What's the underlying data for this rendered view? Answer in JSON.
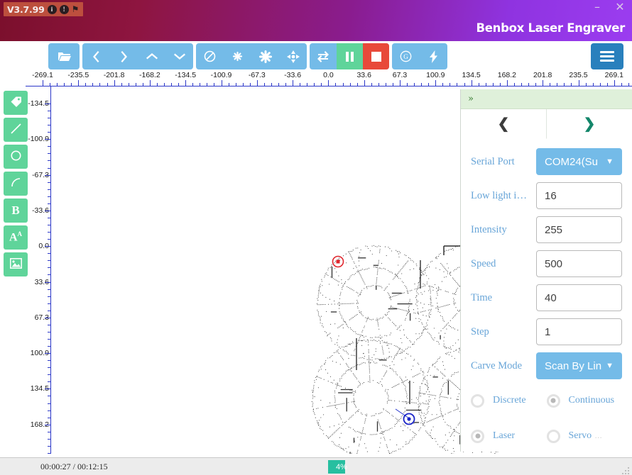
{
  "titlebar": {
    "version": "V3.7.99",
    "icon_info": "i",
    "icon_warn": "!",
    "icon_flag": "⚑",
    "app_title": "Benbox Laser Engraver",
    "minimize": "–",
    "close": "✕"
  },
  "toolbar": {
    "open_label": "folder-open",
    "nav": [
      "left",
      "right",
      "up",
      "down"
    ],
    "ops": [
      "no-entry",
      "asterisk-small",
      "asterisk-large",
      "move-cross"
    ],
    "transfer": "refresh-cycle",
    "pause": "pause",
    "stop": "stop",
    "misc": [
      "g-circle",
      "bolt"
    ],
    "menu": "hamburger"
  },
  "palette": {
    "items": [
      {
        "name": "tag-tool",
        "glyph": "🏷"
      },
      {
        "name": "line-tool",
        "glyph": "╱"
      },
      {
        "name": "circle-tool",
        "glyph": "○"
      },
      {
        "name": "arc-tool",
        "glyph": "⌒"
      },
      {
        "name": "bold-tool",
        "glyph": "B"
      },
      {
        "name": "text-tool",
        "glyph": "Aᴬ"
      },
      {
        "name": "image-tool",
        "glyph": "🖼"
      }
    ]
  },
  "ruler": {
    "top_labels": [
      "-269.1",
      "-235.5",
      "-201.8",
      "-168.2",
      "-134.5",
      "-100.9",
      "-67.3",
      "-33.6",
      "0.0",
      "33.6",
      "67.3",
      "100.9",
      "134.5",
      "168.2",
      "201.8",
      "235.5",
      "269.1"
    ],
    "left_labels": [
      "-134.5",
      "-100.9",
      "-67.3",
      "-33.6",
      "0.0",
      "33.6",
      "67.3",
      "100.9",
      "134.5",
      "168.2"
    ],
    "unit_step": 33.64
  },
  "right_panel": {
    "expander": "»",
    "tab_prev": "❮",
    "tab_next": "❯",
    "fields": [
      {
        "label": "Serial Port",
        "type": "select",
        "value": "COM24(Su"
      },
      {
        "label": "Low light i…",
        "type": "text",
        "value": "16"
      },
      {
        "label": "Intensity",
        "type": "text",
        "value": "255"
      },
      {
        "label": "Speed",
        "type": "text",
        "value": "500"
      },
      {
        "label": "Time",
        "type": "text",
        "value": "40"
      },
      {
        "label": "Step",
        "type": "text",
        "value": "1"
      },
      {
        "label": "Carve Mode",
        "type": "select",
        "value": "Scan By Lin"
      }
    ],
    "radios": [
      {
        "label": "Discrete",
        "checked": false,
        "suffix": ""
      },
      {
        "label": "Continuous",
        "checked": true,
        "suffix": ""
      },
      {
        "label": "Laser",
        "checked": true,
        "suffix": ""
      },
      {
        "label": "Servo",
        "checked": false,
        "suffix": "…"
      }
    ],
    "caret": "▼"
  },
  "statusbar": {
    "time": "00:00:27 / 00:12:15",
    "progress_percent": 4,
    "progress_text": "4%"
  },
  "canvas": {
    "origin_marker": "red-target",
    "cursor_marker": "blue-target",
    "artwork": "dotted-mandala-pattern"
  },
  "colors": {
    "toolbar_blue": "#74bbe8",
    "menu_blue": "#2980bd",
    "green": "#5fd49a",
    "red": "#e8493a",
    "ruler_blue": "#2b37c8",
    "label_blue": "#68a5d8",
    "progress_green": "#27bfa0"
  }
}
